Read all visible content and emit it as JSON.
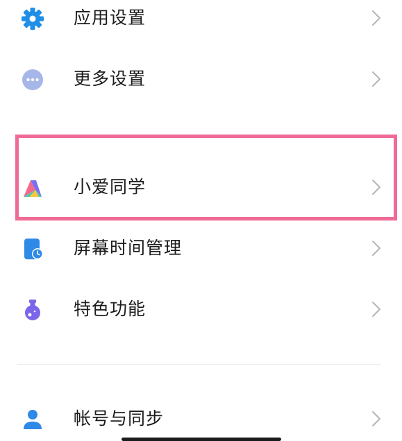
{
  "settings_items": [
    {
      "label": "应用设置",
      "icon": "gear-icon"
    },
    {
      "label": "更多设置",
      "icon": "more-dots-icon"
    },
    {
      "label": "小爱同学",
      "icon": "xiaoai-assistant-icon"
    },
    {
      "label": "屏幕时间管理",
      "icon": "screen-time-icon"
    },
    {
      "label": "特色功能",
      "icon": "flask-icon"
    },
    {
      "label": "帐号与同步",
      "icon": "account-icon"
    }
  ],
  "colors": {
    "highlight_border": "#ef6b95",
    "text": "#1b1b1b",
    "chevron": "#b5b5b5",
    "gear_icon": "#1f8fe8",
    "more_icon": "#a7b6e8",
    "screen_time_icon": "#2f89e7",
    "flask_icon": "#7b66e9",
    "account_icon": "#2f89e7"
  }
}
